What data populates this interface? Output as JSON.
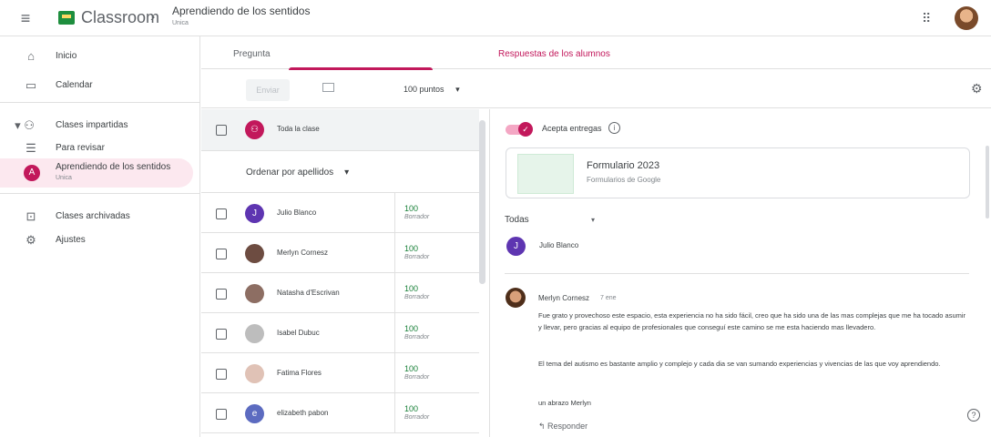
{
  "header": {
    "app_name": "Classroom",
    "separator": "›",
    "course_title": "Aprendiendo de los sentidos",
    "course_subtitle": "Unica",
    "menu_icon": "menu-icon",
    "apps_icon": "apps-grid-icon"
  },
  "sidebar": {
    "items": [
      {
        "label": "Inicio",
        "icon": "home-icon"
      },
      {
        "label": "Calendar",
        "icon": "calendar-icon"
      },
      {
        "label": "Clases impartidas",
        "icon": "people-icon"
      },
      {
        "label": "Para revisar",
        "icon": "todo-icon"
      },
      {
        "label": "Aprendiendo de los sentidos",
        "sub": "Unica",
        "avatar": "A"
      },
      {
        "label": "Clases archivadas",
        "icon": "archive-icon"
      },
      {
        "label": "Ajustes",
        "icon": "gear-icon"
      }
    ]
  },
  "tabs": {
    "question": "Pregunta",
    "answers": "Respuestas de los alumnos"
  },
  "toolbar": {
    "send_label": "Enviar",
    "points": "100 puntos",
    "points_arrow": "▾"
  },
  "list": {
    "all_label": "Toda la clase",
    "sort_label": "Ordenar por apellidos",
    "sort_arrow": "▾",
    "students": [
      {
        "name": "Julio Blanco",
        "initial": "J",
        "color": "#5e35b1",
        "grade": "100",
        "status": "Borrador"
      },
      {
        "name": "Merlyn Cornesz",
        "initial": "",
        "color": "#6d4c41",
        "grade": "100",
        "status": "Borrador"
      },
      {
        "name": "Natasha d'Escrivan",
        "initial": "",
        "color": "#8d6e63",
        "grade": "100",
        "status": "Borrador"
      },
      {
        "name": "Isabel Dubuc",
        "initial": "",
        "color": "#bdbdbd",
        "grade": "100",
        "status": "Borrador"
      },
      {
        "name": "Fatima Flores",
        "initial": "",
        "color": "#e0c2b6",
        "grade": "100",
        "status": "Borrador"
      },
      {
        "name": "elizabeth pabon",
        "initial": "e",
        "color": "#5c6bc0",
        "grade": "100",
        "status": "Borrador"
      }
    ]
  },
  "detail": {
    "accept_label": "Acepta entregas",
    "info": "i",
    "form_title": "Formulario 2023",
    "form_subtitle": "Formularios de Google",
    "filter_label": "Todas",
    "filter_arrow": "▾",
    "student_initial": "J",
    "student_name": "Julio Blanco",
    "comment_author": "Merlyn Cornesz",
    "comment_time": "7 ene",
    "comment_p1": "Fue grato y provechoso este espacio, esta experiencia no ha sido fácil, creo que ha sido una de las mas complejas que me ha tocado asumir y llevar, pero gracias al equipo de profesionales que conseguí este camino se me esta haciendo mas llevadero.",
    "comment_p2": "El tema del autismo es bastante amplio y complejo y cada dia se van sumando experiencias y vivencias de las que voy aprendiendo.",
    "comment_p3": "un abrazo Merlyn",
    "reply_label": "↰ Responder",
    "help": "?"
  }
}
